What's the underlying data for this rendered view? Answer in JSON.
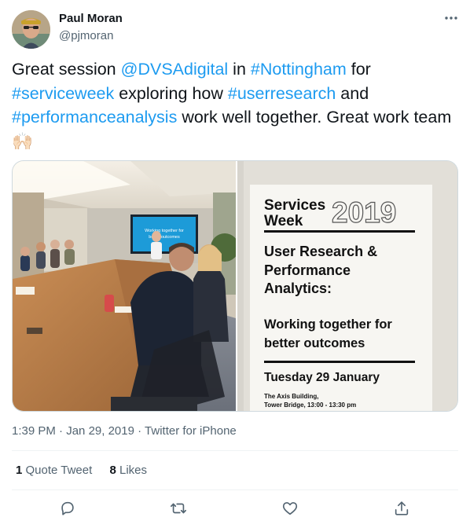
{
  "author": {
    "name": "Paul Moran",
    "handle": "@pjmoran"
  },
  "tweet": {
    "parts": [
      {
        "text": "Great session ",
        "link": false
      },
      {
        "text": "@DVSAdigital",
        "link": true
      },
      {
        "text": " in ",
        "link": false
      },
      {
        "text": "#Nottingham",
        "link": true
      },
      {
        "text": " for ",
        "link": false
      },
      {
        "text": "#serviceweek",
        "link": true
      },
      {
        "text": " exploring how ",
        "link": false
      },
      {
        "text": "#userresearch",
        "link": true
      },
      {
        "text": " and ",
        "link": false
      },
      {
        "text": "#performanceanalysis",
        "link": true
      },
      {
        "text": " work well together. Great work team ",
        "link": false
      }
    ],
    "emoji": "🙌🏻"
  },
  "poster": {
    "heading_line1": "Services",
    "heading_line2": "Week",
    "year": "2019",
    "topic_line1": "User Research &",
    "topic_line2": "Performance",
    "topic_line3": "Analytics:",
    "tag_line1": "Working together for",
    "tag_line2": "better outcomes",
    "date": "Tuesday 29 January",
    "venue_line1": "The Axis Building,",
    "venue_line2": "Tower Bridge, 13:00 - 13:30 pm"
  },
  "screen": {
    "line1": "Working together for",
    "line2": "better outcomes"
  },
  "meta": {
    "time": "1:39 PM",
    "sep1": " · ",
    "date": "Jan 29, 2019",
    "sep2": " · ",
    "source": "Twitter for iPhone"
  },
  "stats": {
    "quote_count": "1",
    "quote_label": " Quote Tweet",
    "like_count": "8",
    "like_label": " Likes"
  },
  "icons": {
    "more": "more-horizontal-icon",
    "reply": "reply-icon",
    "retweet": "retweet-icon",
    "like": "heart-icon",
    "share": "share-icon"
  },
  "colors": {
    "link": "#1d9bf0",
    "secondary_text": "#536471",
    "primary_text": "#0f1419"
  }
}
